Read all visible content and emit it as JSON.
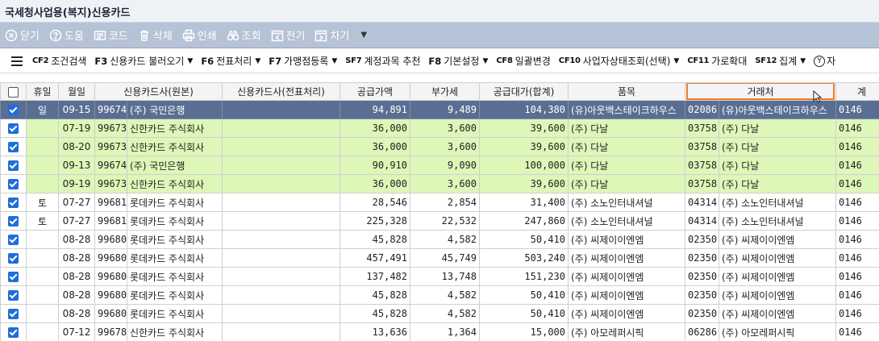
{
  "window": {
    "title": "국세청사업용(복지)신용카드"
  },
  "toolbar": {
    "buttons": [
      {
        "label": "닫기",
        "icon": "close-circle-icon"
      },
      {
        "label": "도움",
        "icon": "help-icon"
      },
      {
        "label": "코드",
        "icon": "code-icon"
      },
      {
        "label": "삭제",
        "icon": "trash-icon"
      },
      {
        "label": "인쇄",
        "icon": "print-icon"
      },
      {
        "label": "조회",
        "icon": "binoculars-icon"
      },
      {
        "label": "전기",
        "icon": "prev-icon"
      },
      {
        "label": "차기",
        "icon": "next-icon"
      }
    ],
    "more": "▼"
  },
  "menu": {
    "items": [
      {
        "key": "CF2",
        "label": "조건검색",
        "caret": false,
        "small": true
      },
      {
        "key": "F3",
        "label": "신용카드 불러오기",
        "caret": true,
        "small": false
      },
      {
        "key": "F6",
        "label": "전표처리",
        "caret": true,
        "small": false
      },
      {
        "key": "F7",
        "label": "가맹점등록",
        "caret": true,
        "small": false
      },
      {
        "key": "SF7",
        "label": "계정과목 추천",
        "caret": false,
        "small": true
      },
      {
        "key": "F8",
        "label": "기본설정",
        "caret": true,
        "small": false
      },
      {
        "key": "CF8",
        "label": "일괄변경",
        "caret": false,
        "small": true
      },
      {
        "key": "CF10",
        "label": "사업자상태조회(선택)",
        "caret": true,
        "small": true
      },
      {
        "key": "CF11",
        "label": "가로확대",
        "caret": false,
        "small": true
      },
      {
        "key": "SF12",
        "label": "집계",
        "caret": true,
        "small": true
      }
    ],
    "trailing_icon": "Y",
    "trailing_label": "자"
  },
  "grid": {
    "columns": [
      "",
      "휴일",
      "월일",
      "신용카드사(원본)",
      "신용카드사(전표처리)",
      "공급가액",
      "부가세",
      "공급대가(합계)",
      "품목",
      "거래처",
      "계"
    ],
    "highlighted_column": 9,
    "rows": [
      {
        "checked": true,
        "style": "sel",
        "holiday": "일",
        "date": "09-15",
        "card_code": "99674",
        "card_name": "(주) 국민은행",
        "card_voucher": "",
        "supply": "94,891",
        "vat": "9,489",
        "total": "104,380",
        "item": "(유)아웃백스테이크하우스",
        "vendor_code": "02086",
        "vendor": "(유)아웃백스테이크하우스",
        "account": "0146"
      },
      {
        "checked": true,
        "style": "grn",
        "holiday": "",
        "date": "07-19",
        "card_code": "99673",
        "card_name": "신한카드 주식회사",
        "card_voucher": "",
        "supply": "36,000",
        "vat": "3,600",
        "total": "39,600",
        "item": "(주) 다날",
        "vendor_code": "03758",
        "vendor": "(주) 다날",
        "account": "0146"
      },
      {
        "checked": true,
        "style": "grn",
        "holiday": "",
        "date": "08-20",
        "card_code": "99673",
        "card_name": "신한카드 주식회사",
        "card_voucher": "",
        "supply": "36,000",
        "vat": "3,600",
        "total": "39,600",
        "item": "(주) 다날",
        "vendor_code": "03758",
        "vendor": "(주) 다날",
        "account": "0146"
      },
      {
        "checked": true,
        "style": "grn",
        "holiday": "",
        "date": "09-13",
        "card_code": "99674",
        "card_name": "(주) 국민은행",
        "card_voucher": "",
        "supply": "90,910",
        "vat": "9,090",
        "total": "100,000",
        "item": "(주) 다날",
        "vendor_code": "03758",
        "vendor": "(주) 다날",
        "account": "0146"
      },
      {
        "checked": true,
        "style": "grn",
        "holiday": "",
        "date": "09-19",
        "card_code": "99673",
        "card_name": "신한카드 주식회사",
        "card_voucher": "",
        "supply": "36,000",
        "vat": "3,600",
        "total": "39,600",
        "item": "(주) 다날",
        "vendor_code": "03758",
        "vendor": "(주) 다날",
        "account": "0146"
      },
      {
        "checked": true,
        "style": "wht",
        "holiday": "토",
        "date": "07-27",
        "card_code": "99681",
        "card_name": "롯데카드 주식회사",
        "card_voucher": "",
        "supply": "28,546",
        "vat": "2,854",
        "total": "31,400",
        "item": "(주) 소노인터내셔널",
        "vendor_code": "04314",
        "vendor": "(주) 소노인터내셔널",
        "account": "0146"
      },
      {
        "checked": true,
        "style": "wht",
        "holiday": "토",
        "date": "07-27",
        "card_code": "99681",
        "card_name": "롯데카드 주식회사",
        "card_voucher": "",
        "supply": "225,328",
        "vat": "22,532",
        "total": "247,860",
        "item": "(주) 소노인터내셔널",
        "vendor_code": "04314",
        "vendor": "(주) 소노인터내셔널",
        "account": "0146"
      },
      {
        "checked": true,
        "style": "wht",
        "holiday": "",
        "date": "08-28",
        "card_code": "99680",
        "card_name": "롯데카드 주식회사",
        "card_voucher": "",
        "supply": "45,828",
        "vat": "4,582",
        "total": "50,410",
        "item": "(주) 씨제이이엔엠",
        "vendor_code": "02350",
        "vendor": "(주) 씨제이이엔엠",
        "account": "0146"
      },
      {
        "checked": true,
        "style": "wht",
        "holiday": "",
        "date": "08-28",
        "card_code": "99680",
        "card_name": "롯데카드 주식회사",
        "card_voucher": "",
        "supply": "457,491",
        "vat": "45,749",
        "total": "503,240",
        "item": "(주) 씨제이이엔엠",
        "vendor_code": "02350",
        "vendor": "(주) 씨제이이엔엠",
        "account": "0146"
      },
      {
        "checked": true,
        "style": "wht",
        "holiday": "",
        "date": "08-28",
        "card_code": "99680",
        "card_name": "롯데카드 주식회사",
        "card_voucher": "",
        "supply": "137,482",
        "vat": "13,748",
        "total": "151,230",
        "item": "(주) 씨제이이엔엠",
        "vendor_code": "02350",
        "vendor": "(주) 씨제이이엔엠",
        "account": "0146"
      },
      {
        "checked": true,
        "style": "wht",
        "holiday": "",
        "date": "08-28",
        "card_code": "99680",
        "card_name": "롯데카드 주식회사",
        "card_voucher": "",
        "supply": "45,828",
        "vat": "4,582",
        "total": "50,410",
        "item": "(주) 씨제이이엔엠",
        "vendor_code": "02350",
        "vendor": "(주) 씨제이이엔엠",
        "account": "0146"
      },
      {
        "checked": true,
        "style": "wht",
        "holiday": "",
        "date": "08-28",
        "card_code": "99680",
        "card_name": "롯데카드 주식회사",
        "card_voucher": "",
        "supply": "45,828",
        "vat": "4,582",
        "total": "50,410",
        "item": "(주) 씨제이이엔엠",
        "vendor_code": "02350",
        "vendor": "(주) 씨제이이엔엠",
        "account": "0146"
      },
      {
        "checked": true,
        "style": "wht",
        "holiday": "",
        "date": "07-12",
        "card_code": "99678",
        "card_name": "신한카드 주식회사",
        "card_voucher": "",
        "supply": "13,636",
        "vat": "1,364",
        "total": "15,000",
        "item": "(주) 아모레퍼시픽",
        "vendor_code": "06286",
        "vendor": "(주) 아모레퍼시픽",
        "account": "0146"
      }
    ]
  },
  "colors": {
    "toolbar_bg": "#b6c3d6",
    "selected_row": "#5a6e93",
    "green_row": "#ddf7b8",
    "highlight_border": "#f07c2a",
    "checkbox": "#1e6fd9"
  }
}
